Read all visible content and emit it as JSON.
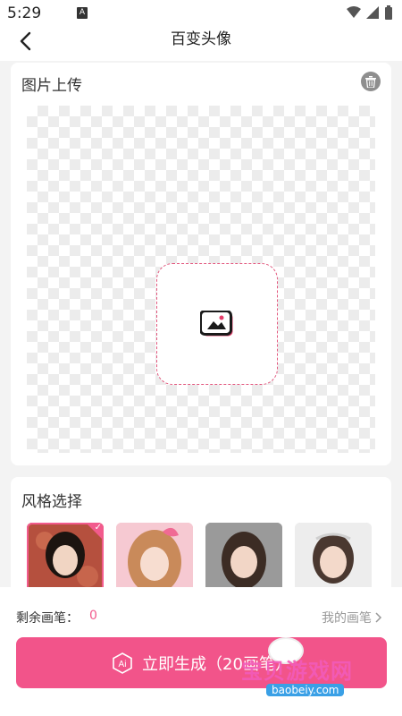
{
  "status": {
    "time": "5:29",
    "app_icon": "A"
  },
  "nav": {
    "title": "百变头像"
  },
  "upload": {
    "title": "图片上传"
  },
  "style": {
    "title": "风格选择",
    "thumbs": [
      {
        "name": "style-chinese",
        "bg": "#b5503e",
        "selected": true
      },
      {
        "name": "style-pink",
        "bg": "#f2a7b6",
        "selected": false
      },
      {
        "name": "style-office",
        "bg": "#8c8c8c",
        "selected": false
      },
      {
        "name": "style-bride",
        "bg": "#e8e8e8",
        "selected": false
      }
    ]
  },
  "bottom": {
    "remain_label": "剩余画笔：",
    "remain_value": "0",
    "my_strokes": "我的画笔",
    "generate_label": "立即生成（20画笔）",
    "ai_badge": "Ai"
  },
  "watermark": {
    "text": "宝贝游戏网",
    "url": "baobeiy.com"
  },
  "colors": {
    "accent": "#f2548a",
    "dashed_border": "#e2577e"
  },
  "icons": [
    "back-icon",
    "delete-icon",
    "image-icon",
    "chevron-right-icon",
    "wifi-icon",
    "signal-icon",
    "battery-icon",
    "ai-badge-icon"
  ]
}
